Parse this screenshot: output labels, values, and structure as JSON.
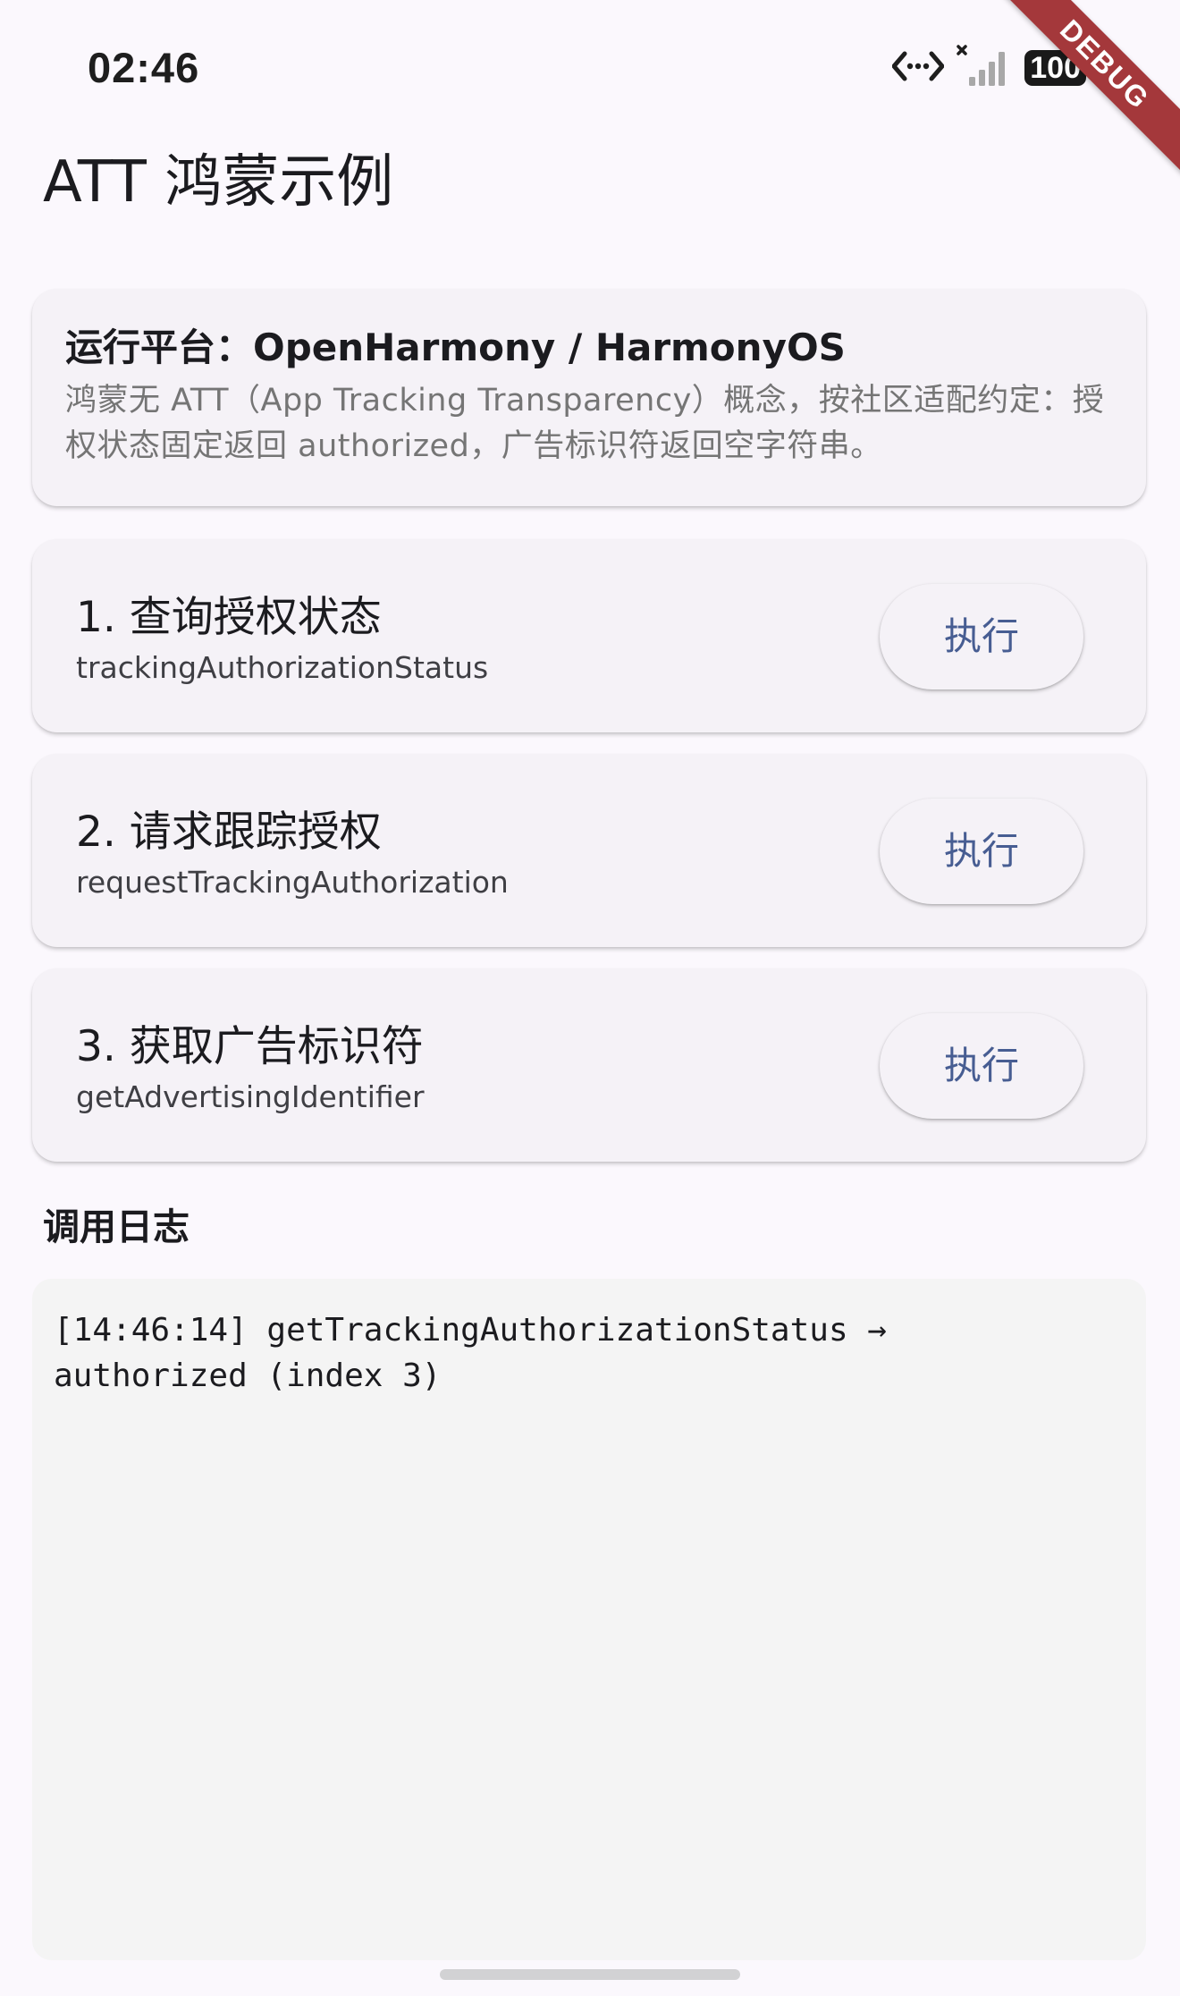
{
  "status_bar": {
    "time": "02:46",
    "icons": [
      "data-transfer-icon",
      "no-sim-icon",
      "cellular-signal-icon",
      "battery-icon"
    ],
    "battery_level": "100"
  },
  "debug_banner": "DEBUG",
  "app_bar": {
    "title": "ATT 鸿蒙示例"
  },
  "platform": {
    "title": "运行平台：OpenHarmony / HarmonyOS",
    "description": "鸿蒙无 ATT（App Tracking Transparency）概念，按社区适配约定：授权状态固定返回 authorized，广告标识符返回空字符串。"
  },
  "actions": [
    {
      "title": "1. 查询授权状态",
      "method": "trackingAuthorizationStatus",
      "button_label": "执行"
    },
    {
      "title": "2. 请求跟踪授权",
      "method": "requestTrackingAuthorization",
      "button_label": "执行"
    },
    {
      "title": "3. 获取广告标识符",
      "method": "getAdvertisingIdentifier",
      "button_label": "执行"
    }
  ],
  "log": {
    "heading": "调用日志",
    "entries": [
      "[14:46:14] getTrackingAuthorizationStatus → authorized (index 3)"
    ]
  },
  "colors": {
    "background": "#fbf8fd",
    "card": "#f5f2f7",
    "button_text": "#475d92",
    "debug_ribbon": "#a4383b"
  }
}
